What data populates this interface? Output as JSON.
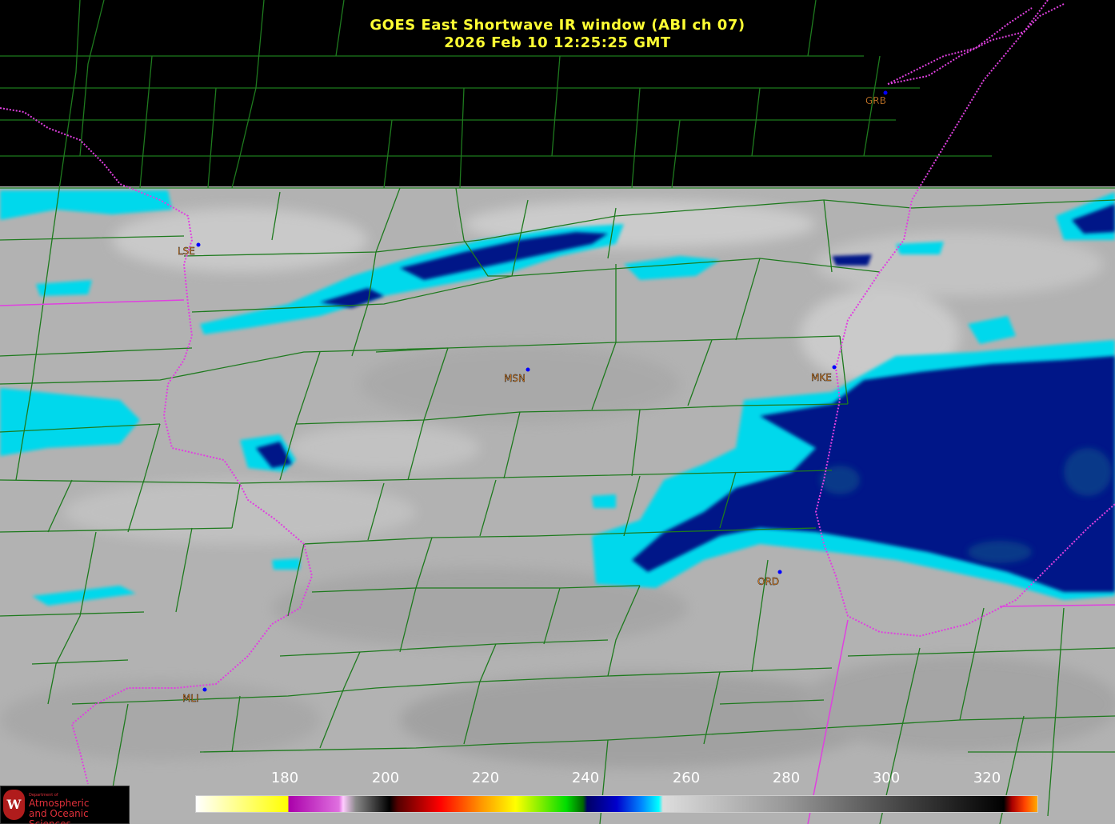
{
  "title": {
    "line1": "GOES East Shortwave IR window (ABI ch 07)",
    "line2": "2026 Feb 10  12:25:25 GMT"
  },
  "stations": [
    {
      "id": "GRB",
      "color": "#ff9933"
    },
    {
      "id": "LSE",
      "color": "#ff9933"
    },
    {
      "id": "MSN",
      "color": "#ff9933"
    },
    {
      "id": "MKE",
      "color": "#ff9933"
    },
    {
      "id": "ORD",
      "color": "#ff9933"
    },
    {
      "id": "MLI",
      "color": "#ff9933"
    }
  ],
  "colorbar": {
    "ticks": [
      "180",
      "200",
      "220",
      "240",
      "260",
      "280",
      "300",
      "320"
    ],
    "range_min": 162,
    "range_max": 330
  },
  "logo": {
    "badge": "W",
    "dept": "Department of",
    "line1": "Atmospheric",
    "line2": "and Oceanic Sciences"
  },
  "colors": {
    "county_lines": "#1e7a1e",
    "state_lines": "#e040e0",
    "cloud_gray": "#b4b4b4",
    "cold_cloud_cyan": "#00e0f0",
    "cold_cloud_navy": "#00107a"
  }
}
